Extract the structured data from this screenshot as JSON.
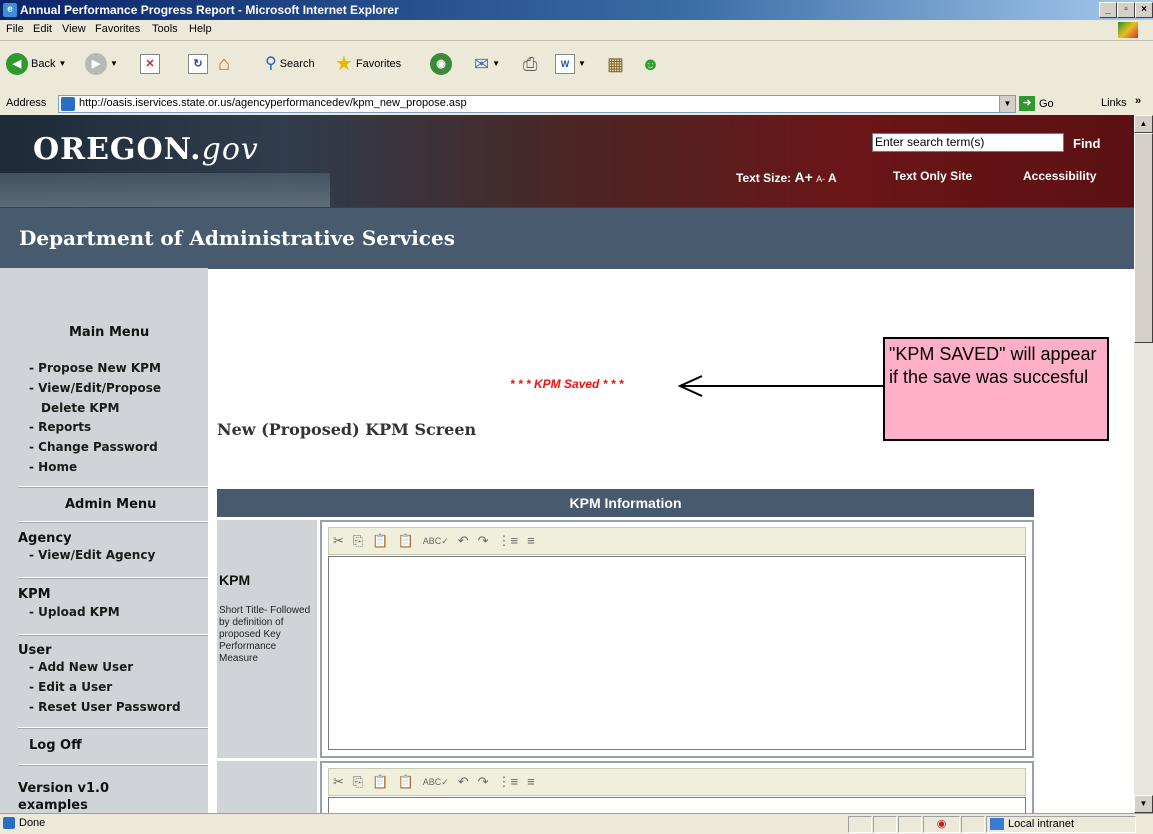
{
  "window": {
    "title": "Annual Performance Progress Report - Microsoft Internet Explorer",
    "controls": {
      "minimize": "_",
      "maximize": "▫",
      "close": "×"
    }
  },
  "menubar": [
    "File",
    "Edit",
    "View",
    "Favorites",
    "Tools",
    "Help"
  ],
  "toolbar": {
    "back": "Back",
    "search": "Search",
    "favorites": "Favorites"
  },
  "addressbar": {
    "label": "Address",
    "url": "http://oasis.iservices.state.or.us/agencyperformancedev/kpm_new_propose.asp",
    "go": "Go",
    "links": "Links"
  },
  "site": {
    "logo_main": "OREGON.",
    "logo_suffix": "gov",
    "search_placeholder": "Enter search term(s)",
    "find": "Find",
    "text_size_label": "Text Size:",
    "text_size_large": "A+",
    "text_size_small": "A-",
    "text_size_normal": "A",
    "text_only": "Text Only Site",
    "accessibility": "Accessibility",
    "department": "Department of Administrative Services"
  },
  "sidebar": {
    "main_menu_title": "Main Menu",
    "main_items": [
      "- Propose New KPM",
      "- View/Edit/Propose",
      "Delete KPM",
      "- Reports",
      "- Change Password",
      "- Home"
    ],
    "admin_menu_title": "Admin Menu",
    "agency_title": "Agency",
    "agency_items": [
      "- View/Edit Agency"
    ],
    "kpm_title": "KPM",
    "kpm_items": [
      "- Upload KPM"
    ],
    "user_title": "User",
    "user_items": [
      "- Add New User",
      "- Edit a User",
      "- Reset User Password"
    ],
    "logoff": "Log Off",
    "version": "Version v1.0",
    "version_sub": "examples"
  },
  "main": {
    "saved_message": "* * * KPM Saved * * *",
    "page_title": "New (Proposed) KPM Screen",
    "callout": "\"KPM SAVED\" will appear if the save was succesful",
    "section_header": "KPM Information",
    "kpm_label": "KPM",
    "kpm_help": "Short Title- Followed by definition of proposed Key Performance Measure",
    "editor_buttons": [
      "✂",
      "⎘",
      "📋",
      "📋",
      "ABC✓",
      "↶",
      "↷",
      "⋮≡",
      "≡"
    ]
  },
  "statusbar": {
    "status": "Done",
    "zone": "Local intranet"
  }
}
